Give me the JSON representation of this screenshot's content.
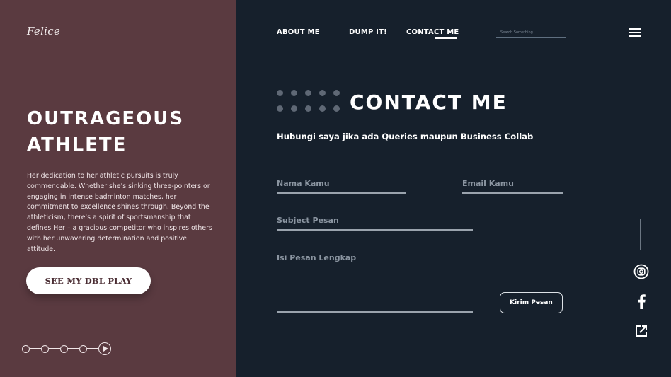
{
  "brand": {
    "logo": "Felice"
  },
  "hero": {
    "title_line1": "OUTRAGEOUS",
    "title_line2": "ATHLETE",
    "description": "Her dedication to her athletic pursuits is truly commendable. Whether she's sinking three-pointers or engaging in intense badminton matches, her commitment to excellence shines through. Beyond the athleticism, there's a spirit of sportsmanship that defines Her – a gracious competitor who inspires others with her unwavering determination and positive attitude.",
    "cta_label": "SEE MY DBL PLAY"
  },
  "slider": {
    "step_count": 4,
    "active_control": "play-icon"
  },
  "nav": {
    "items": [
      {
        "label": "ABOUT ME"
      },
      {
        "label": "DUMP IT!"
      },
      {
        "label": "CONTACT ME",
        "active": true
      }
    ],
    "search_placeholder": "Search Something",
    "menu_icon": "hamburger-menu-icon"
  },
  "contact": {
    "title": "CONTACT ME",
    "subtitle": "Hubungi saya jika ada Queries maupun Business Collab",
    "fields": {
      "name_placeholder": "Nama Kamu",
      "email_placeholder": "Email Kamu",
      "subject_placeholder": "Subject Pesan",
      "message_placeholder": "Isi Pesan Lengkap"
    },
    "submit_label": "Kirim Pesan"
  },
  "social": [
    "instagram-icon",
    "facebook-icon",
    "external-link-icon"
  ],
  "colors": {
    "left_panel": "#5a3a40",
    "right_panel": "#16202c",
    "dot_pattern": "#5f6875",
    "text": "#ffffff"
  }
}
